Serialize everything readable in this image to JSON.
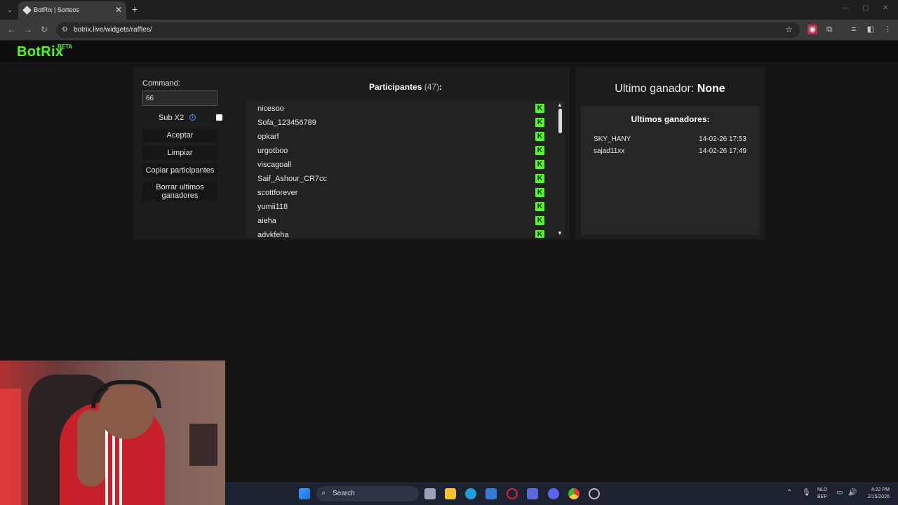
{
  "browser": {
    "tab_title": "BotRix | Sorteos",
    "url": "botrix.live/widgets/raffles/",
    "new_tab": "+",
    "tab_close": "✕"
  },
  "app": {
    "logo": "BotRix",
    "logo_badge": "BETA"
  },
  "controls": {
    "command_label": "Command:",
    "command_value": "66",
    "subx2_label": "Sub X2",
    "subx2_checked": false,
    "accept_label": "Aceptar",
    "clear_label": "Limpiar",
    "copy_label": "Copiar participantes",
    "delete_label_line1": "Borrar ultimos",
    "delete_label_line2": "ganadores"
  },
  "participants": {
    "title": "Participantes",
    "count": "(47)",
    "suffix": ":",
    "items": [
      "nicesoo",
      "Sofa_123456789",
      "opkarf",
      "urgotboo",
      "viscagoall",
      "Saif_Ashour_CR7cc",
      "scottforever",
      "yumii118",
      "aieha",
      "advkfeha"
    ],
    "platform_icon": "kick-icon"
  },
  "winner": {
    "label": "Ultimo ganador:",
    "value": "None",
    "recent_title": "Ultimos ganadores:",
    "recent": [
      {
        "name": "SKY_HANY",
        "date": "14-02-26 17:53"
      },
      {
        "name": "sajad11xx",
        "date": "14-02-26 17:49"
      }
    ]
  },
  "taskbar": {
    "search_label": "Search",
    "lang_line1": "NLD",
    "lang_line2": "BEP",
    "time": "4:22 PM",
    "date": "2/15/2026"
  },
  "colors": {
    "accent": "#53fc18",
    "background": "#141414",
    "panel": "#1c1c1c"
  }
}
